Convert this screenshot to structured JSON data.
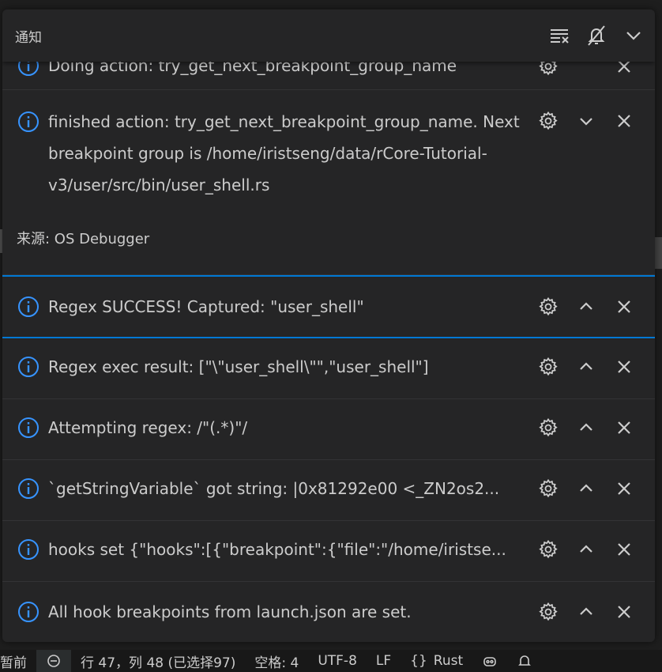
{
  "panel": {
    "title": "通知",
    "header_icons": [
      "clear-all-icon",
      "do-not-disturb-icon",
      "collapse-icon"
    ]
  },
  "notifications": [
    {
      "message": "Doing action: try_get_next_breakpoint_group_name",
      "state": "clipped"
    },
    {
      "message": "finished action: try_get_next_breakpoint_group_name. Next breakpoint group is /home/iristseng/data/rCore-Tutorial-v3/user/src/bin/user_shell.rs",
      "source_label": "来源: OS Debugger",
      "state": "expanded"
    },
    {
      "message": "Regex SUCCESS! Captured: \"user_shell\"",
      "state": "focused"
    },
    {
      "message": "Regex exec result: [\"\\\"user_shell\\\"\",\"user_shell\"]",
      "state": "normal"
    },
    {
      "message": "Attempting regex: /\"(.*)\"/",
      "state": "normal"
    },
    {
      "message": "`getStringVariable` got string: |0x81292e00 <_ZN2os2...",
      "state": "normal"
    },
    {
      "message": "hooks set {\"hooks\":[{\"breakpoint\":{\"file\":\"/home/iristse...",
      "state": "normal"
    },
    {
      "message": "All hook breakpoints from launch.json are set.",
      "state": "normal"
    }
  ],
  "statusbar": {
    "left_fragment": "暂前",
    "position": "行 47，列 48 (已选择97)",
    "spaces": "空格: 4",
    "encoding": "UTF-8",
    "eol": "LF",
    "language_braces": "{}",
    "language": "Rust"
  },
  "colors": {
    "accent": "#0078d4",
    "info_icon": "#3794ff",
    "panel_bg": "#252526"
  }
}
